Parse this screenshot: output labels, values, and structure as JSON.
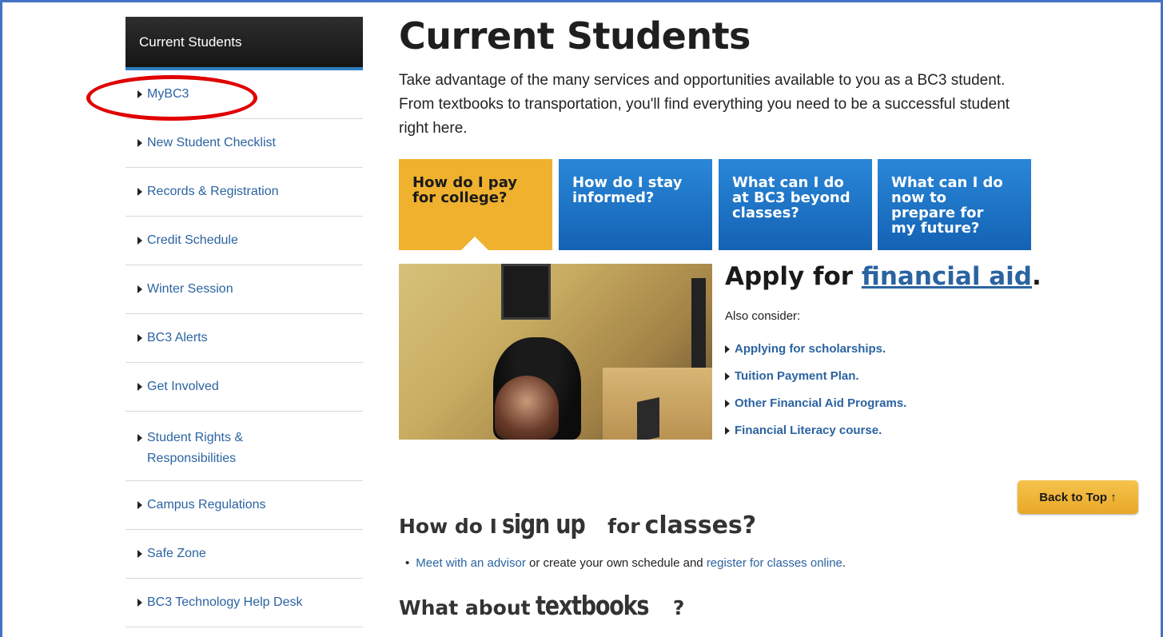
{
  "sidebar": {
    "header": "Current Students",
    "items": [
      {
        "label": "MyBC3"
      },
      {
        "label": "New Student Checklist"
      },
      {
        "label": "Records & Registration"
      },
      {
        "label": "Credit Schedule"
      },
      {
        "label": "Winter Session"
      },
      {
        "label": "BC3 Alerts"
      },
      {
        "label": "Get Involved"
      },
      {
        "label": "Student Rights & Responsibilities"
      },
      {
        "label": "Campus Regulations"
      },
      {
        "label": "Safe Zone"
      },
      {
        "label": "BC3 Technology Help Desk"
      }
    ]
  },
  "main": {
    "title": "Current Students",
    "intro": "Take advantage of the many services and opportunities available to you as a BC3 student. From textbooks to transportation, you'll find everything you need to be a successful student right here.",
    "tiles": [
      {
        "label": "How do I pay for college?",
        "active": true
      },
      {
        "label": "How do I stay informed?",
        "active": false
      },
      {
        "label": "What can I do at BC3 beyond classes?",
        "active": false
      },
      {
        "label": "What can I do now to prepare for my future?",
        "active": false
      }
    ],
    "apply": {
      "prefix": "Apply for ",
      "link": "financial aid",
      "suffix": ".",
      "also": "Also consider:",
      "links": [
        "Applying for scholarships.",
        "Tuition Payment Plan.",
        "Other Financial Aid Programs.",
        "Financial Literacy course."
      ]
    },
    "back_to_top": "Back to Top ↑",
    "signup": {
      "pre": "How do I",
      "big": "sign up",
      "mid": "for",
      "classes": "classes",
      "post": "?",
      "advisor_link": "Meet with an advisor",
      "middle_text": " or create your own schedule and ",
      "register_link": "register for classes online",
      "end": "."
    },
    "textbooks": {
      "pre": "What about",
      "big": "textbooks",
      "post": "?"
    }
  },
  "colors": {
    "accent_blue": "#2b63a1",
    "tile_blue": "#1462b4",
    "tile_gold": "#efb12e",
    "annotation_red": "#e00000"
  }
}
